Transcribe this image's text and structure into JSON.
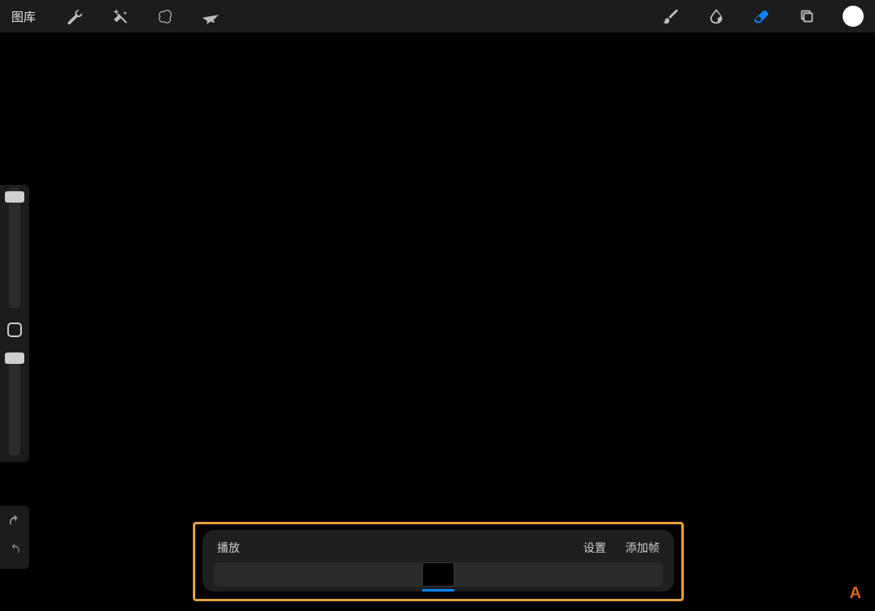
{
  "toolbar": {
    "gallery_label": "图库",
    "left_tools": [
      {
        "name": "wrench-icon"
      },
      {
        "name": "magic-wand-icon"
      },
      {
        "name": "selection-icon"
      },
      {
        "name": "move-arrow-icon"
      }
    ],
    "right_tools": [
      {
        "name": "paint-brush-icon",
        "active": false
      },
      {
        "name": "smudge-icon",
        "active": false
      },
      {
        "name": "eraser-icon",
        "active": true
      },
      {
        "name": "layers-icon",
        "active": false
      }
    ],
    "color_chip_hex": "#ffffff"
  },
  "side_sliders": {
    "brush_size_percent": 95,
    "opacity_percent": 99
  },
  "undo_redo": {
    "undo_enabled": true,
    "redo_enabled": false
  },
  "animation_panel": {
    "play_label": "播放",
    "settings_label": "设置",
    "add_frame_label": "添加帧",
    "current_frame_index": 0,
    "frame_count": 1
  },
  "accent_colors": {
    "highlight_border": "#e6a23c",
    "active_tool": "#0a84ff"
  },
  "corner_mark": "A"
}
